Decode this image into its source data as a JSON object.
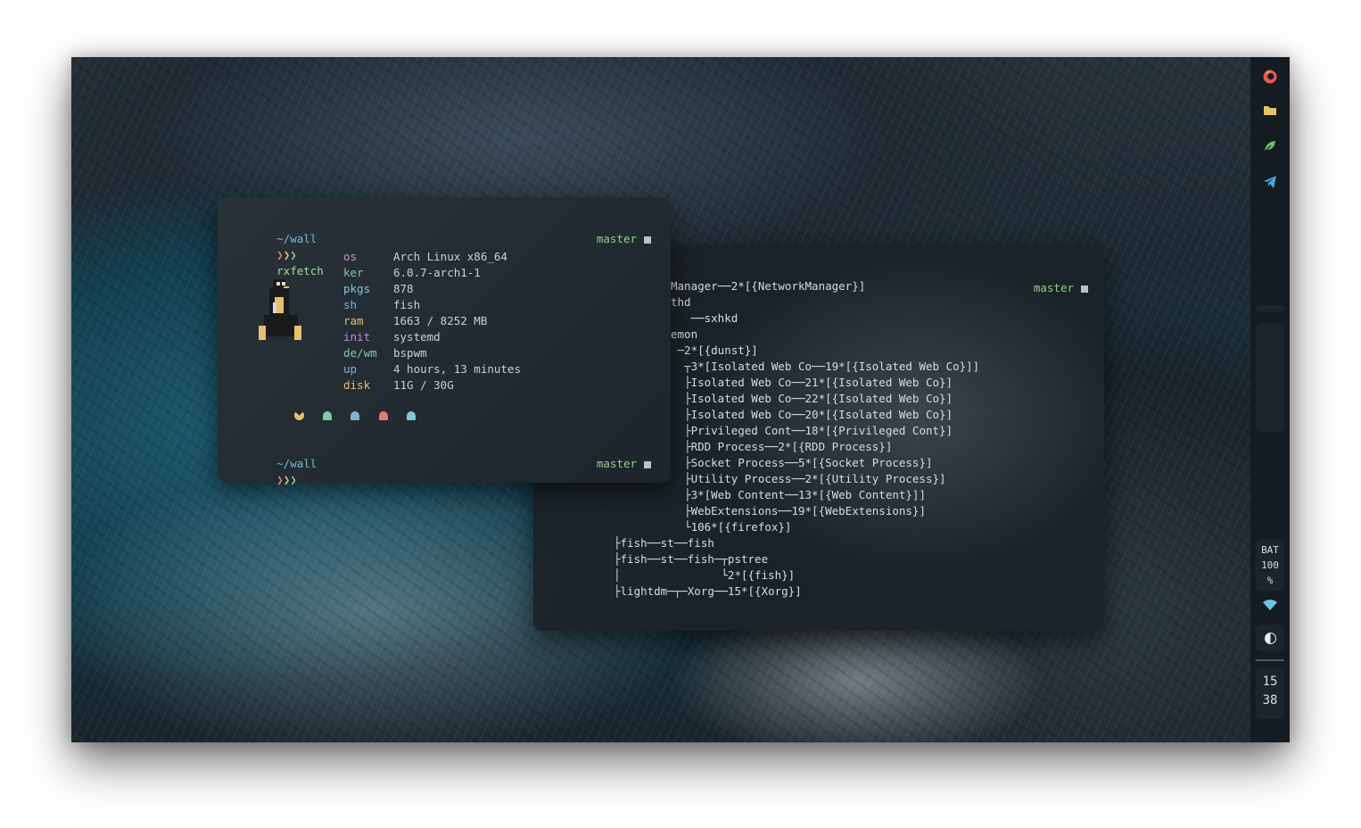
{
  "fetch": {
    "prompt_dir": "~/wall",
    "arrows": [
      "❯",
      "❯",
      "❯"
    ],
    "command": "rxfetch",
    "git_branch": "master",
    "info": [
      {
        "key": "os",
        "value": "Arch Linux x86_64"
      },
      {
        "key": "ker",
        "value": "6.0.7-arch1-1"
      },
      {
        "key": "pkgs",
        "value": "878"
      },
      {
        "key": "sh",
        "value": "fish"
      },
      {
        "key": "ram",
        "value": "1663 / 8252 MB"
      },
      {
        "key": "init",
        "value": "systemd"
      },
      {
        "key": "de/wm",
        "value": "bspwm"
      },
      {
        "key": "up",
        "value": "4 hours, 13 minutes"
      },
      {
        "key": "disk",
        "value": "11G / 30G"
      }
    ],
    "second_prompt_dir": "~/wall",
    "second_git_branch": "master",
    "glyph_colors": [
      "#e6c06a",
      "#7ec9a6",
      "#7fb4d6",
      "#e87a6b",
      "#7ec9d6"
    ]
  },
  "pstree": {
    "git_branch": "master",
    "lines": [
      "Manager──2*[{NetworkManager}]",
      "thd",
      "   ──sxhkd",
      "emon",
      " ─2*[{dunst}]",
      "  ┬3*[Isolated Web Co──19*[{Isolated Web Co}]]",
      "  ├Isolated Web Co──21*[{Isolated Web Co}]",
      "  ├Isolated Web Co──22*[{Isolated Web Co}]",
      "  ├Isolated Web Co──20*[{Isolated Web Co}]",
      "  ├Privileged Cont──18*[{Privileged Cont}]",
      "  ├RDD Process──2*[{RDD Process}]",
      "  ├Socket Process──5*[{Socket Process}]",
      "  ├Utility Process──2*[{Utility Process}]",
      "  ├3*[Web Content──13*[{Web Content}]]",
      "  ├WebExtensions──19*[{WebExtensions}]",
      "  └106*[{firefox}]",
      "├fish──st──fish",
      "├fish──st──fish─┬pstree",
      "│               └2*[{fish}]",
      "├lightdm─┬─Xorg──15*[{Xorg}]"
    ]
  },
  "bar": {
    "bat_label": "BAT",
    "bat_value": "100",
    "bat_unit": "%",
    "clock_hour": "15",
    "clock_min": "38",
    "icons": [
      "firefox-icon",
      "folder-icon",
      "leaf-icon",
      "telegram-icon",
      "wifi-icon",
      "contrast-icon"
    ]
  }
}
